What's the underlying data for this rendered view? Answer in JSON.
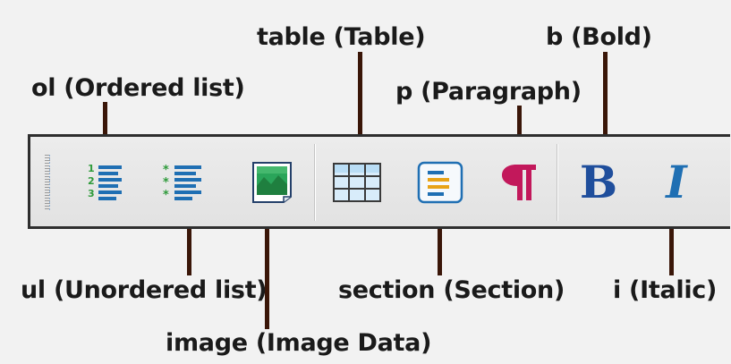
{
  "labels": {
    "ol": "ol (Ordered list)",
    "table": "table (Table)",
    "p": "p (Paragraph)",
    "b": "b (Bold)",
    "ul": "ul (Unordered list)",
    "image": "image (Image Data)",
    "section": "section (Section)",
    "i": "i (Italic)"
  },
  "toolbar": {
    "buttons": [
      {
        "id": "ordered-list",
        "icon": "ordered-list-icon"
      },
      {
        "id": "unordered-list",
        "icon": "unordered-list-icon"
      },
      {
        "id": "image",
        "icon": "image-icon"
      },
      {
        "id": "table",
        "icon": "table-icon"
      },
      {
        "id": "section",
        "icon": "section-icon"
      },
      {
        "id": "paragraph",
        "icon": "pilcrow-icon"
      },
      {
        "id": "bold",
        "icon": "bold-icon",
        "glyph": "B"
      },
      {
        "id": "italic",
        "icon": "italic-icon",
        "glyph": "I"
      }
    ]
  },
  "colors": {
    "leader": "#3a1608",
    "list_blue": "#1f6fb3",
    "list_green": "#2e9a3a",
    "pilcrow": "#c2185b",
    "bold_blue": "#1f4e9c"
  }
}
